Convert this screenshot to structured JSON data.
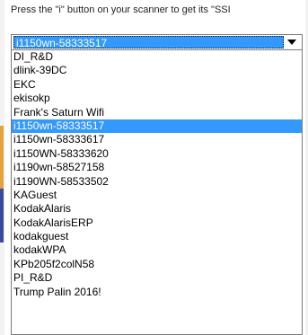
{
  "instruction": "Press the \"i\" button on your scanner to get its \"SSI",
  "combo": {
    "selected_value": "i1150wn-58333517"
  },
  "dropdown": {
    "items": [
      "DI_R&D",
      "dlink-39DC",
      "EKC",
      "ekisokp",
      "Frank's Saturn Wifi",
      "i1150wn-58333517",
      "i1150wn-58333617",
      "i1150WN-58333620",
      "i1190wn-58527158",
      "i1190WN-58533502",
      "KAGuest",
      "KodakAlaris",
      "KodakAlarisERP",
      "kodakguest",
      "kodakWPA",
      "KPb205f2colN58",
      "PI_R&D",
      "Trump Palin 2016!"
    ],
    "highlighted_index": 5
  },
  "colors": {
    "selection": "#3399ff"
  }
}
